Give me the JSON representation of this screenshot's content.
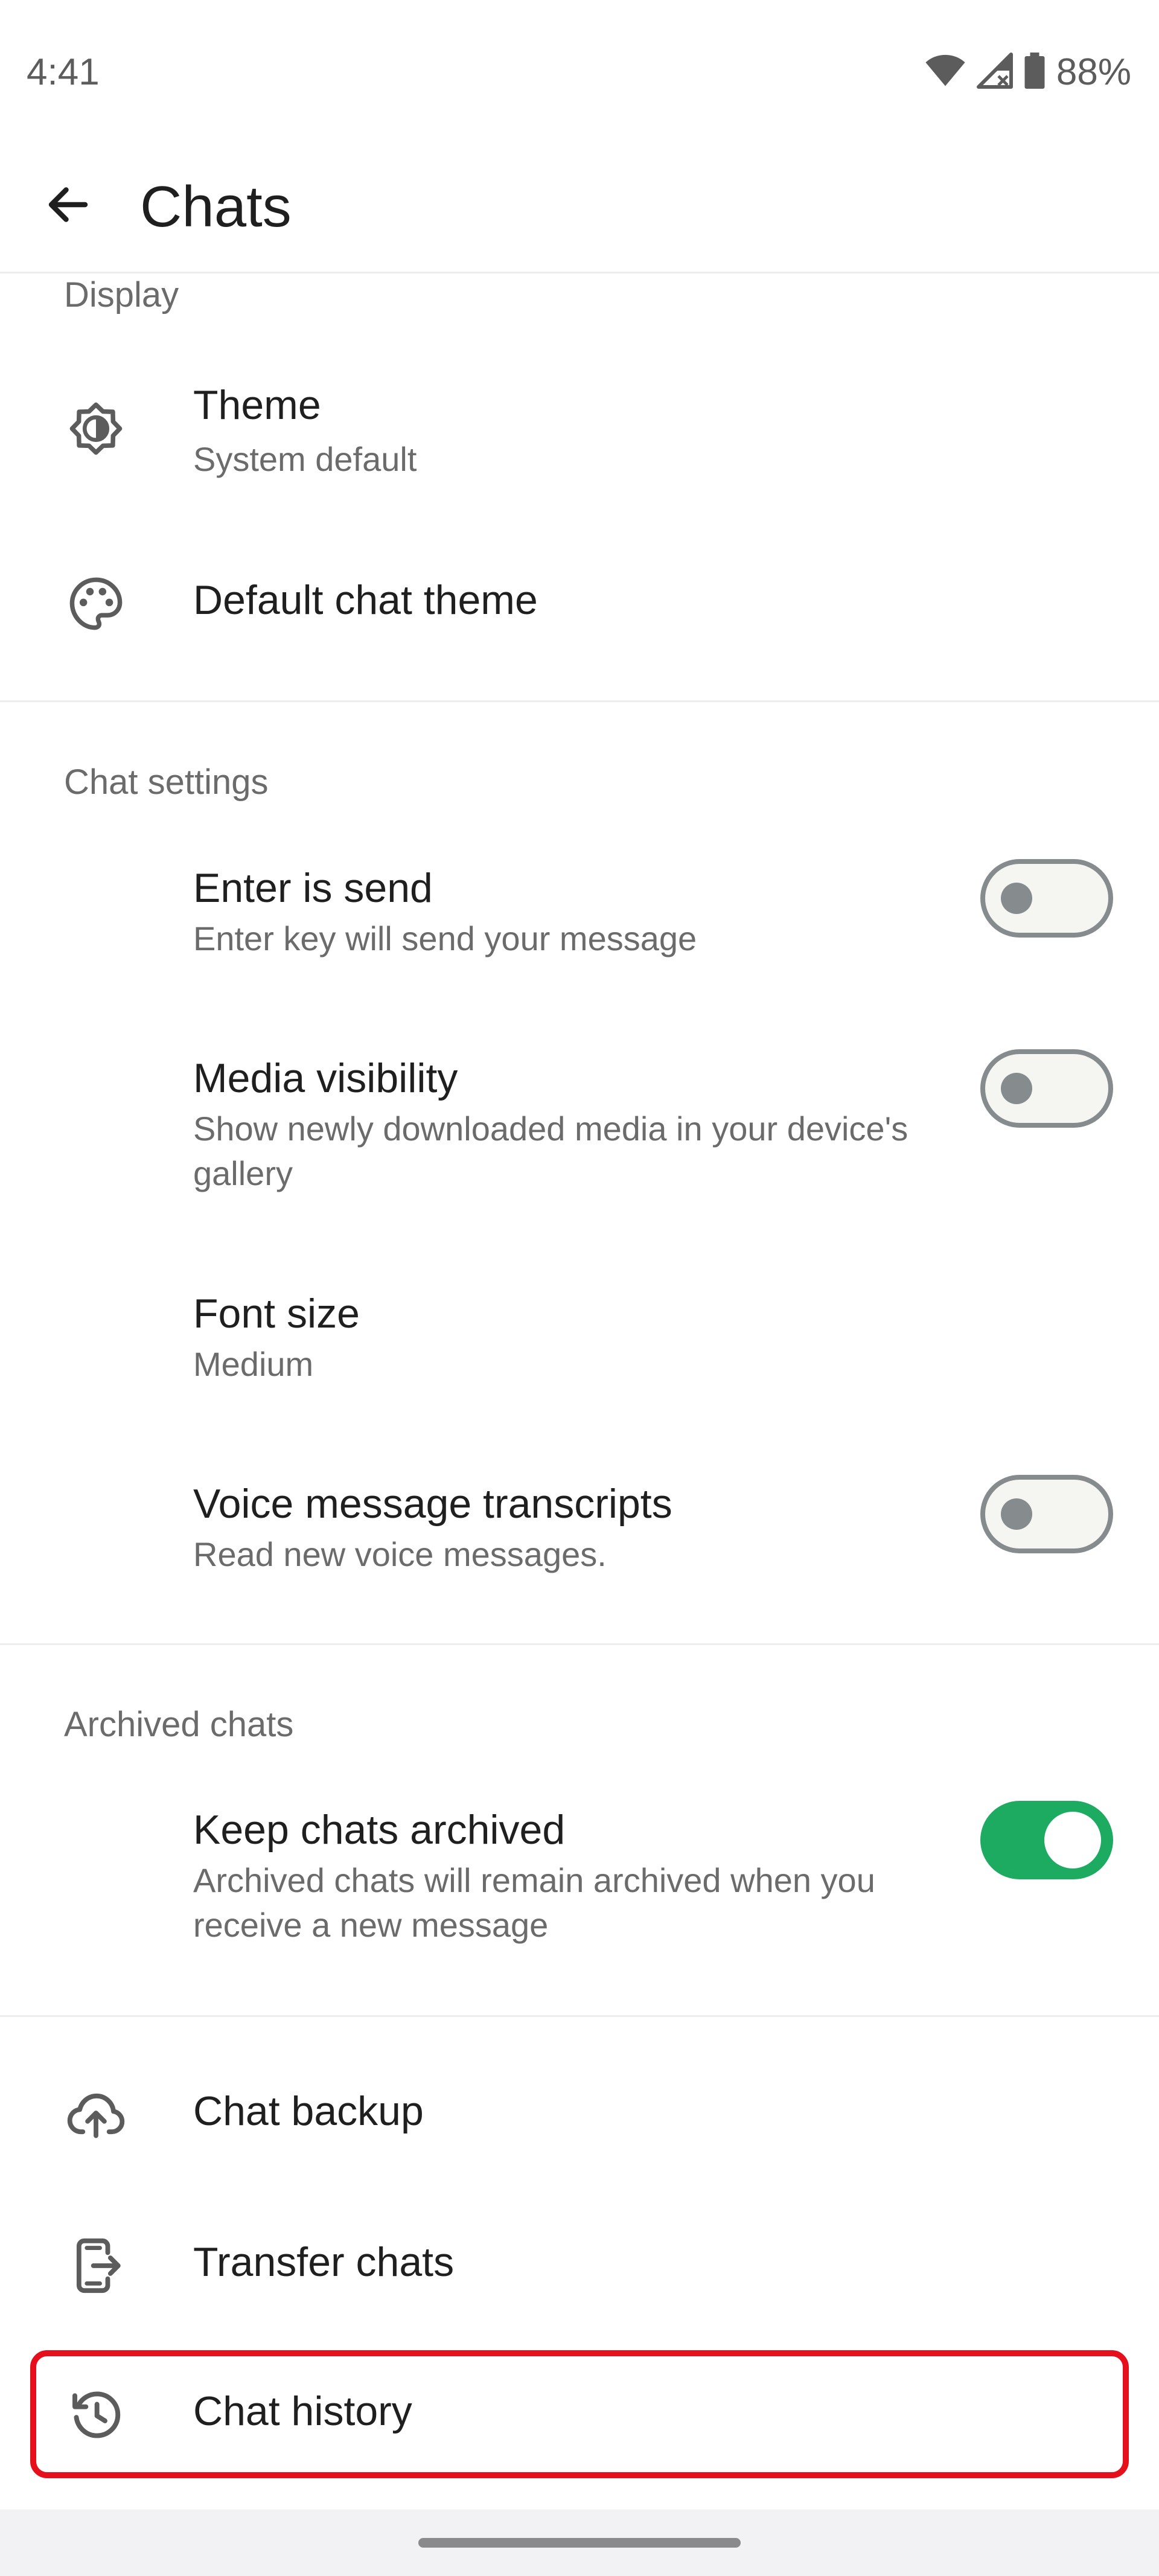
{
  "status_bar": {
    "time": "4:41",
    "battery": "88%",
    "icons": [
      "wifi-icon",
      "cellular-signal-icon",
      "battery-icon"
    ]
  },
  "header": {
    "title": "Chats",
    "back_icon": "arrow-back-icon"
  },
  "sections": {
    "display": {
      "header": "Display",
      "theme": {
        "title": "Theme",
        "subtitle": "System default",
        "icon": "theme-icon"
      },
      "default_chat_theme": {
        "title": "Default chat theme",
        "icon": "palette-icon"
      }
    },
    "chat_settings": {
      "header": "Chat settings",
      "enter_is_send": {
        "title": "Enter is send",
        "subtitle": "Enter key will send your message",
        "enabled": false
      },
      "media_visibility": {
        "title": "Media visibility",
        "subtitle": "Show newly downloaded media in your device's gallery",
        "enabled": false
      },
      "font_size": {
        "title": "Font size",
        "subtitle": "Medium"
      },
      "voice_transcripts": {
        "title": "Voice message transcripts",
        "subtitle": "Read new voice messages.",
        "enabled": false
      }
    },
    "archived_chats": {
      "header": "Archived chats",
      "keep_archived": {
        "title": "Keep chats archived",
        "subtitle": "Archived chats will remain archived when you receive a new message",
        "enabled": true
      }
    },
    "more": {
      "chat_backup": {
        "title": "Chat backup",
        "icon": "cloud-upload-icon"
      },
      "transfer_chats": {
        "title": "Transfer chats",
        "icon": "transfer-phone-icon"
      },
      "chat_history": {
        "title": "Chat history",
        "icon": "history-icon"
      }
    }
  },
  "colors": {
    "accent_green": "#1daa61",
    "highlight_red": "#e5101b",
    "toggle_off": "#868b8e",
    "text_primary": "#1f1f1f",
    "text_secondary": "#6b6b6b"
  }
}
